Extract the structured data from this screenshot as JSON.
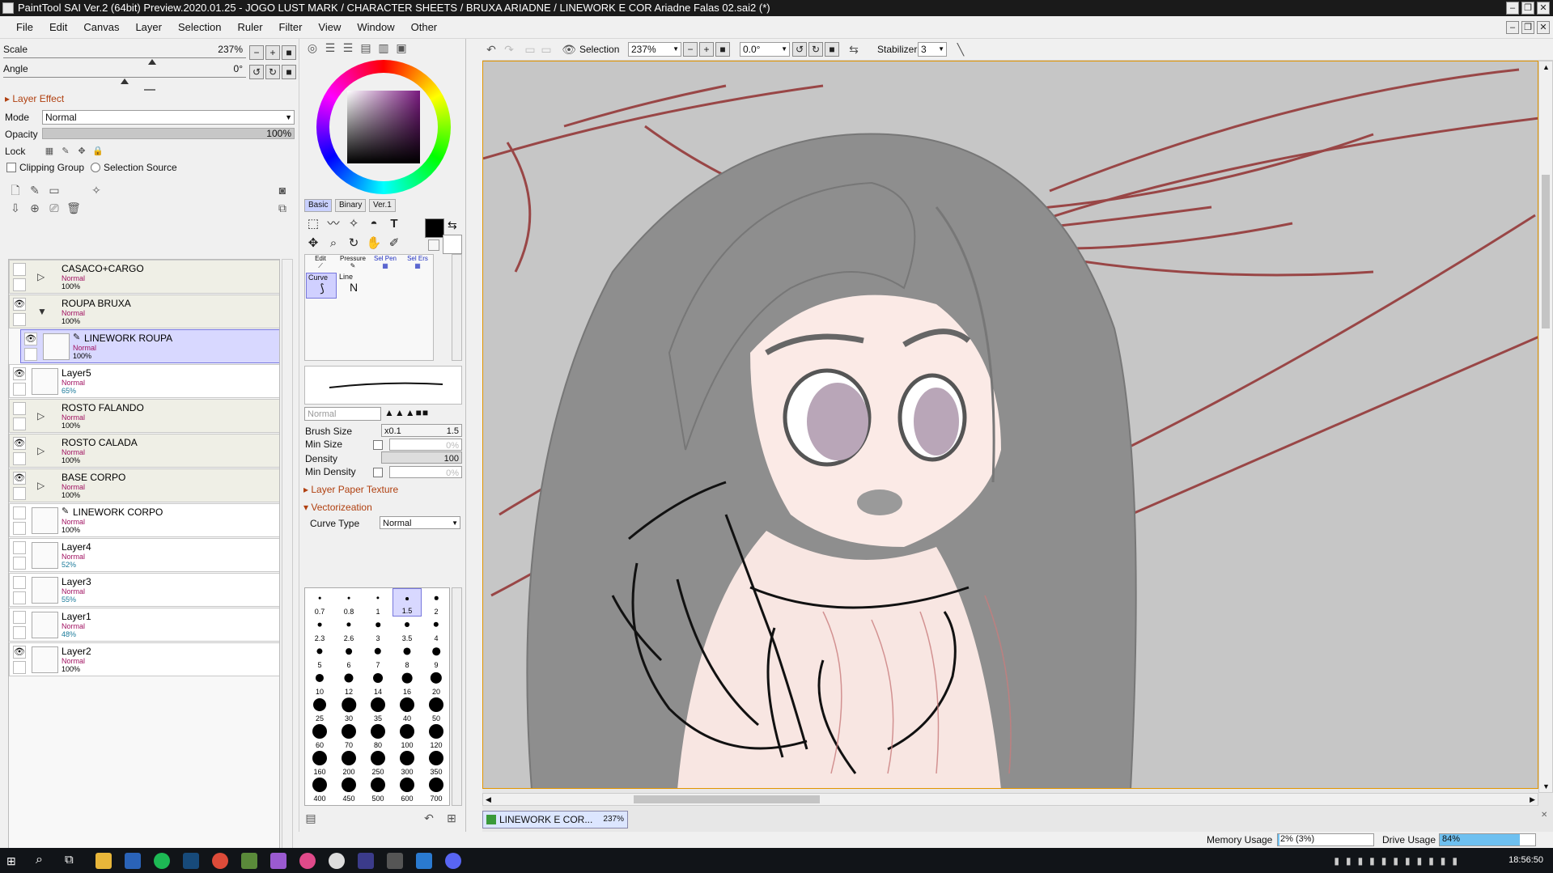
{
  "window": {
    "title": "PaintTool SAI Ver.2 (64bit) Preview.2020.01.25 - JOGO LUST MARK / CHARACTER SHEETS / BRUXA ARIADNE / LINEWORK E COR Ariadne Falas 02.sai2 (*)"
  },
  "menu": [
    "File",
    "Edit",
    "Canvas",
    "Layer",
    "Selection",
    "Ruler",
    "Filter",
    "View",
    "Window",
    "Other"
  ],
  "nav": {
    "scale_label": "Scale",
    "scale_value": "237%",
    "angle_label": "Angle",
    "angle_value": "0°"
  },
  "layer_effect": {
    "section_label": "Layer Effect",
    "mode_label": "Mode",
    "mode_value": "Normal",
    "opacity_label": "Opacity",
    "opacity_value": "100%",
    "opacity_fraction": 1.0,
    "lock_label": "Lock",
    "clipping_label": "Clipping Group",
    "selection_source_label": "Selection Source"
  },
  "layers": [
    {
      "name": "CASACO+CARGO",
      "mode": "Normal",
      "opacity": "100%",
      "folder": true,
      "collapsed": true,
      "visible": false,
      "selected": false
    },
    {
      "name": "ROUPA BRUXA",
      "mode": "Normal",
      "opacity": "100%",
      "folder": true,
      "collapsed": false,
      "visible": true,
      "selected": false
    },
    {
      "name": "LINEWORK ROUPA",
      "mode": "Normal",
      "opacity": "100%",
      "folder": false,
      "indent": true,
      "visible": true,
      "selected": true,
      "pen": true
    },
    {
      "name": "Layer5",
      "mode": "Normal",
      "opacity": "65%",
      "folder": false,
      "visible": true,
      "selected": false
    },
    {
      "name": "ROSTO FALANDO",
      "mode": "Normal",
      "opacity": "100%",
      "folder": true,
      "collapsed": true,
      "visible": false,
      "selected": false
    },
    {
      "name": "ROSTO CALADA",
      "mode": "Normal",
      "opacity": "100%",
      "folder": true,
      "collapsed": true,
      "visible": true,
      "selected": false
    },
    {
      "name": "BASE CORPO",
      "mode": "Normal",
      "opacity": "100%",
      "folder": true,
      "collapsed": true,
      "visible": true,
      "selected": false
    },
    {
      "name": "LINEWORK CORPO",
      "mode": "Normal",
      "opacity": "100%",
      "folder": false,
      "visible": false,
      "selected": false,
      "pen": true
    },
    {
      "name": "Layer4",
      "mode": "Normal",
      "opacity": "52%",
      "folder": false,
      "visible": false,
      "selected": false
    },
    {
      "name": "Layer3",
      "mode": "Normal",
      "opacity": "55%",
      "folder": false,
      "visible": false,
      "selected": false
    },
    {
      "name": "Layer1",
      "mode": "Normal",
      "opacity": "48%",
      "folder": false,
      "visible": false,
      "selected": false
    },
    {
      "name": "Layer2",
      "mode": "Normal",
      "opacity": "100%",
      "folder": false,
      "visible": true,
      "selected": false
    }
  ],
  "toolpanel": {
    "tabs": [
      "Basic",
      "Binary",
      "Ver.1"
    ],
    "tools_row3": [
      "Edit",
      "Pressure",
      "Sel Pen",
      "Sel Ers"
    ],
    "tools_row4": [
      "Curve",
      "Line"
    ],
    "blend_mode": "Normal",
    "brush_size_label": "Brush Size",
    "brush_size_mult": "x0.1",
    "brush_size_value": "1.5",
    "min_size_label": "Min Size",
    "min_size_value": "0%",
    "density_label": "Density",
    "density_value": "100",
    "min_density_label": "Min Density",
    "min_density_value": "0%",
    "paper_texture_label": "Layer Paper Texture",
    "vectorization_label": "Vectorizeation",
    "curve_type_label": "Curve Type",
    "curve_type_value": "Normal",
    "brush_sizes": [
      "0.7",
      "0.8",
      "1",
      "1.5",
      "2",
      "2.3",
      "2.6",
      "3",
      "3.5",
      "4",
      "5",
      "6",
      "7",
      "8",
      "9",
      "10",
      "12",
      "14",
      "16",
      "20",
      "25",
      "30",
      "35",
      "40",
      "50",
      "60",
      "70",
      "80",
      "100",
      "120",
      "160",
      "200",
      "250",
      "300",
      "350",
      "400",
      "450",
      "500",
      "600",
      "700"
    ],
    "selected_brush_size": "1.5"
  },
  "canvas_toolbar": {
    "selection_label": "Selection",
    "zoom_value": "237%",
    "angle_value": "0.0°",
    "stabilizer_label": "Stabilizer",
    "stabilizer_value": "3"
  },
  "document_tab": {
    "name": "LINEWORK E COR...",
    "zoom": "237%"
  },
  "status": {
    "memory_label": "Memory Usage",
    "memory_value": "2% (3%)",
    "memory_fraction": 0.02,
    "drive_label": "Drive Usage",
    "drive_value": "84%",
    "drive_fraction": 0.84
  },
  "taskbar": {
    "clock": "18:56:50"
  },
  "colors": {
    "primary": "#000000",
    "secondary": "#ffffff",
    "hue_picker": "#7a1a80",
    "accent": "#e29500"
  }
}
